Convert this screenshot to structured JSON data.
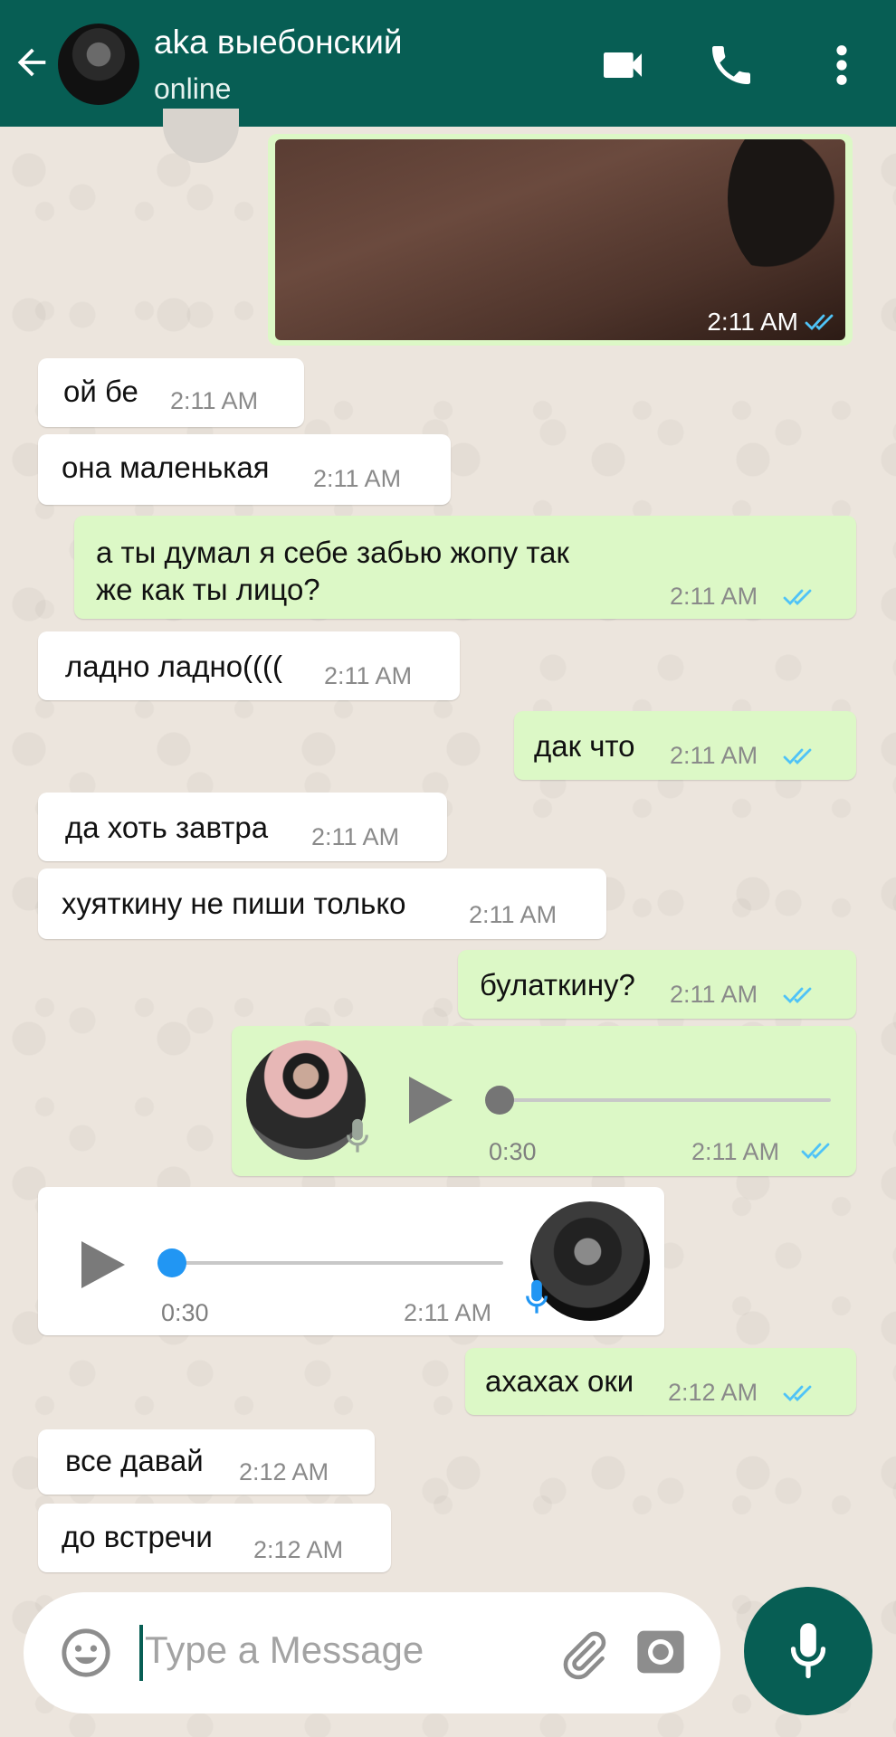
{
  "header": {
    "contact_name": "aka выебонский",
    "status": "online"
  },
  "photo_message": {
    "time": "2:11 AM"
  },
  "messages": [
    {
      "dir": "in",
      "text": "ой бе",
      "time": "2:11 AM"
    },
    {
      "dir": "in",
      "text": "она маленькая",
      "time": "2:11 AM"
    },
    {
      "dir": "out",
      "text": "а ты думал я себе забью жопу так\nже как ты лицо?",
      "time": "2:11 AM"
    },
    {
      "dir": "in",
      "text": "ладно ладно((((",
      "time": "2:11 AM"
    },
    {
      "dir": "out",
      "text": "дак что",
      "time": "2:11 AM"
    },
    {
      "dir": "in",
      "text": "да хоть завтра",
      "time": "2:11 AM"
    },
    {
      "dir": "in",
      "text": "хуяткину не пиши только",
      "time": "2:11 AM"
    },
    {
      "dir": "out",
      "text": "булаткину?",
      "time": "2:11 AM"
    },
    {
      "dir": "out",
      "text": "ахахах оки",
      "time": "2:12 AM"
    },
    {
      "dir": "in",
      "text": "все давай",
      "time": "2:12 AM"
    },
    {
      "dir": "in",
      "text": "до встречи",
      "time": "2:12 AM"
    }
  ],
  "voice_out": {
    "duration": "0:30",
    "time": "2:11 AM",
    "progress": 0
  },
  "voice_in": {
    "duration": "0:30",
    "time": "2:11 AM",
    "progress": 0
  },
  "composer": {
    "placeholder": "Type a Message"
  },
  "colors": {
    "header": "#075e54",
    "outgoing_bubble": "#dcf8c6",
    "incoming_bubble": "#ffffff",
    "read_ticks": "#4fc3f7",
    "voice_played": "#2196f3"
  },
  "icons": [
    "back-arrow-icon",
    "video-call-icon",
    "phone-icon",
    "more-vert-icon",
    "double-check-icon",
    "play-icon",
    "mic-icon",
    "emoji-icon",
    "attach-icon",
    "camera-icon"
  ]
}
